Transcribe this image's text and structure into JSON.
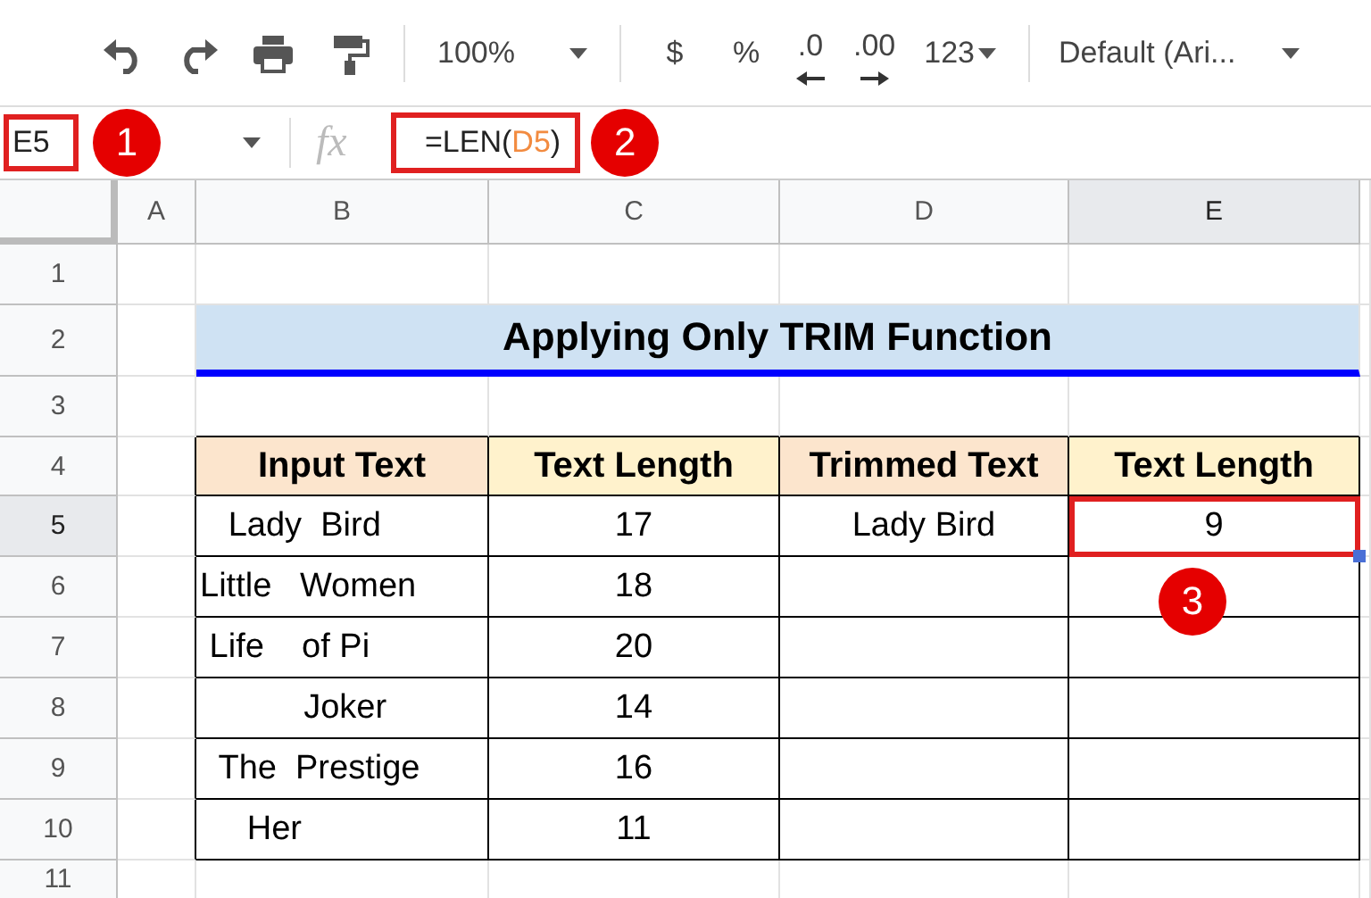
{
  "toolbar": {
    "zoom": "100%",
    "currency": "$",
    "percent": "%",
    "decrease_decimals": ".0",
    "increase_decimals": ".00",
    "number_format": "123",
    "font": "Default (Ari..."
  },
  "formula_bar": {
    "cell_ref": "E5",
    "fx": "fx",
    "formula": [
      {
        "kind": "text",
        "text": "=LEN("
      },
      {
        "kind": "ref",
        "text": "D5"
      },
      {
        "kind": "text",
        "text": ")"
      }
    ]
  },
  "callouts": [
    "1",
    "2",
    "3"
  ],
  "columns": [
    {
      "label": "A",
      "selected": false
    },
    {
      "label": "B",
      "selected": false
    },
    {
      "label": "C",
      "selected": false
    },
    {
      "label": "D",
      "selected": false
    },
    {
      "label": "E",
      "selected": true
    }
  ],
  "rows": [
    {
      "label": "1",
      "selected": false
    },
    {
      "label": "2",
      "selected": false
    },
    {
      "label": "3",
      "selected": false
    },
    {
      "label": "4",
      "selected": false
    },
    {
      "label": "5",
      "selected": true
    },
    {
      "label": "6",
      "selected": false
    },
    {
      "label": "7",
      "selected": false
    },
    {
      "label": "8",
      "selected": false
    },
    {
      "label": "9",
      "selected": false
    },
    {
      "label": "10",
      "selected": false
    },
    {
      "label": "11",
      "selected": false
    }
  ],
  "title": "Applying Only TRIM Function",
  "table": {
    "columns": [
      {
        "label": "Input Text",
        "color": "#fce5cd"
      },
      {
        "label": "Text Length",
        "color": "#fff2cc"
      },
      {
        "label": "Trimmed Text",
        "color": "#fce5cd"
      },
      {
        "label": "Text Length",
        "color": "#fff2cc"
      }
    ],
    "rows": [
      [
        "   Lady  Bird",
        "17",
        "Lady Bird",
        "9"
      ],
      [
        "Little   Women",
        "18",
        "",
        ""
      ],
      [
        " Life    of Pi",
        "20",
        "",
        ""
      ],
      [
        "           Joker",
        "14",
        "",
        ""
      ],
      [
        "  The  Prestige",
        "16",
        "",
        ""
      ],
      [
        "     Her",
        "11",
        "",
        ""
      ]
    ]
  }
}
